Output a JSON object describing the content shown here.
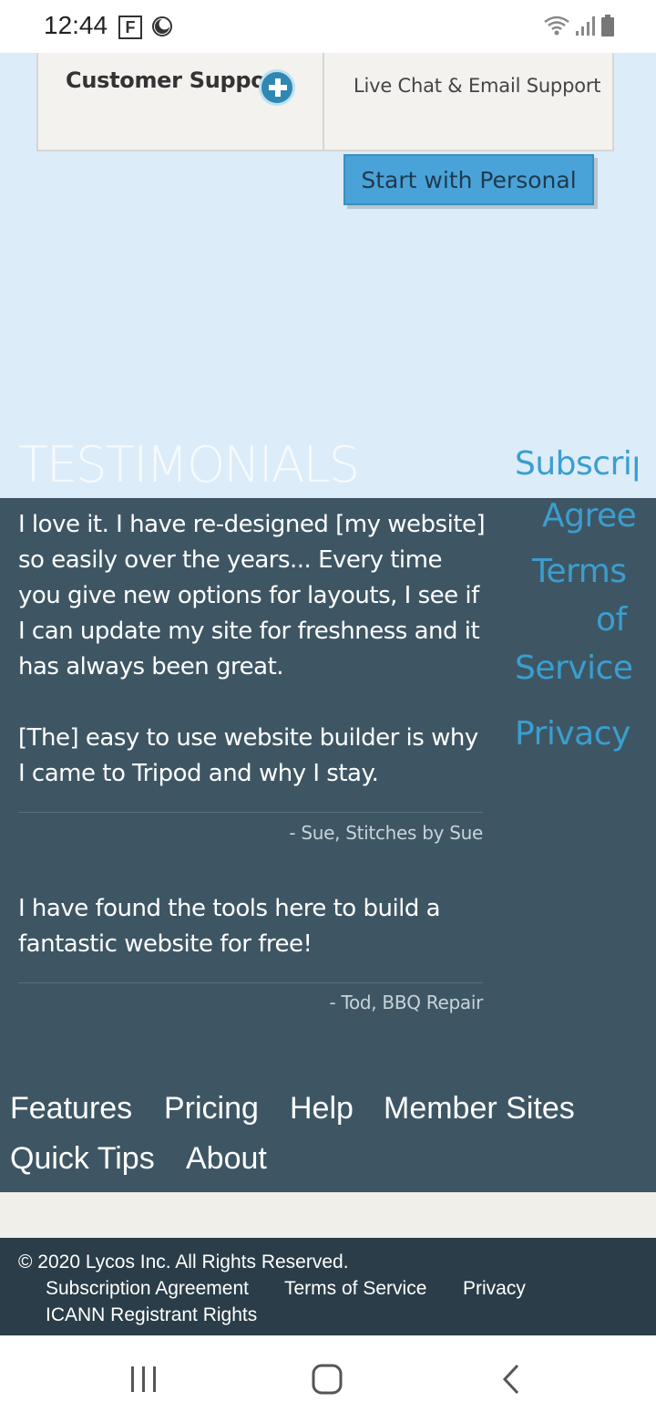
{
  "status_bar": {
    "time": "12:44",
    "f_badge": "F",
    "icons": [
      "moon-icon",
      "wifi-icon",
      "signal-icon",
      "battery-icon"
    ]
  },
  "feature_row": {
    "label": "Customer Support",
    "value": "Live Chat & Email Support",
    "icon": "plus-circle-icon"
  },
  "cta": {
    "label": "Start with Personal"
  },
  "testimonials": {
    "title": "TESTIMONIALS",
    "items": [
      {
        "paragraphs": [
          "I love it. I have re-designed [my website] so easily over the years... Every time you give new options for layouts, I see if I can update my site for freshness and it has always been great.",
          "[The] easy to use website builder is why I came to Tripod and why I stay."
        ],
        "author": "- Sue, Stitches by Sue"
      },
      {
        "paragraphs": [
          "I have found the tools here to build a fantastic website for free!"
        ],
        "author": "- Tod, BBQ Repair"
      }
    ]
  },
  "side_links": [
    {
      "text": "Subscrip"
    },
    {
      "text": "Agreer"
    },
    {
      "text": "Terms"
    },
    {
      "text": "of"
    },
    {
      "text": "Service"
    },
    {
      "text": "Privacy"
    }
  ],
  "footer_nav": [
    "Features",
    "Pricing",
    "Help",
    "Member Sites",
    "Quick Tips",
    "About"
  ],
  "legal": {
    "copyright": "© 2020 Lycos Inc. All Rights Reserved.",
    "links": [
      "Subscription Agreement",
      "Terms of Service",
      "Privacy",
      "ICANN Registrant Rights"
    ]
  },
  "colors": {
    "accent": "#3a9ecf",
    "dark_section": "#3e5664",
    "legal_bg": "#2a3d48",
    "page_bg": "#dcecf8",
    "button": "#4aa3d8"
  },
  "system_nav": [
    "recent-apps-icon",
    "home-icon",
    "back-icon"
  ]
}
